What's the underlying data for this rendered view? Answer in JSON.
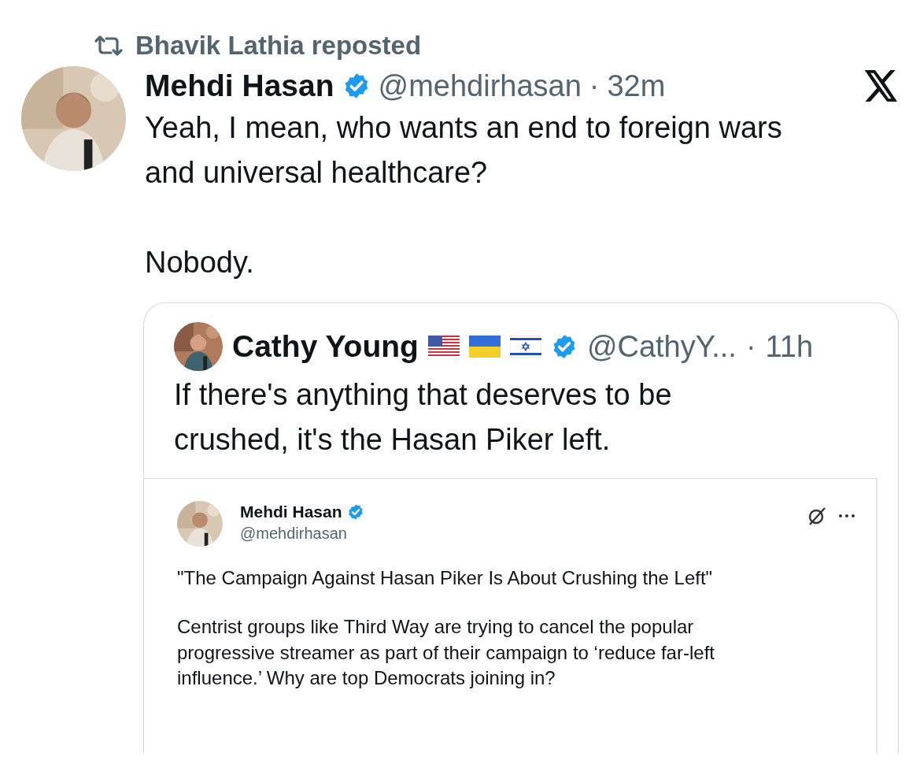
{
  "repost": {
    "label": "Bhavik Lathia reposted"
  },
  "tweet": {
    "name": "Mehdi Hasan",
    "verified": true,
    "handle": "@mehdirhasan",
    "separator": "·",
    "time": "32m",
    "text": "Yeah, I mean, who wants an end to foreign wars\nand universal healthcare?\n\nNobody."
  },
  "quote": {
    "name": "Cathy Young",
    "verified": true,
    "handle": "@CathyY...",
    "separator": "·",
    "time": "11h",
    "text": "If there's anything that deserves to be\ncrushed, it's the Hasan Piker left."
  },
  "embedded": {
    "name": "Mehdi Hasan",
    "verified": true,
    "handle": "@mehdirhasan",
    "headline": "\"The Campaign Against Hasan Piker Is About Crushing the Left\"",
    "text": "Centrist groups like Third Way are trying to cancel the popular\nprogressive streamer as part of their campaign to ‘reduce far-left\ninfluence.’ Why are top Democrats joining in?"
  }
}
